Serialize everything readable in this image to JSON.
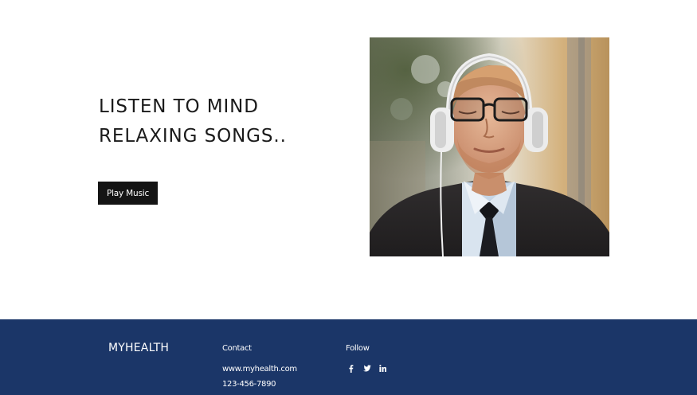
{
  "hero": {
    "heading_line1": "LISTEN TO MIND",
    "heading_line2": "RELAXING SONGS..",
    "button_label": "Play Music",
    "photo_subject": "man-with-headphones"
  },
  "footer": {
    "brand": "MYHEALTH",
    "contact": {
      "heading": "Contact",
      "website": "www.myhealth.com",
      "phone": "123-456-7890"
    },
    "follow": {
      "heading": "Follow",
      "icons": [
        "facebook-icon",
        "twitter-icon",
        "linkedin-icon"
      ]
    }
  },
  "colors": {
    "background": "#ffffff",
    "heading_text": "#1a1a1a",
    "button_background": "#141414",
    "button_text": "#ffffff",
    "footer_background": "#1b3668",
    "footer_text": "#ffffff"
  }
}
